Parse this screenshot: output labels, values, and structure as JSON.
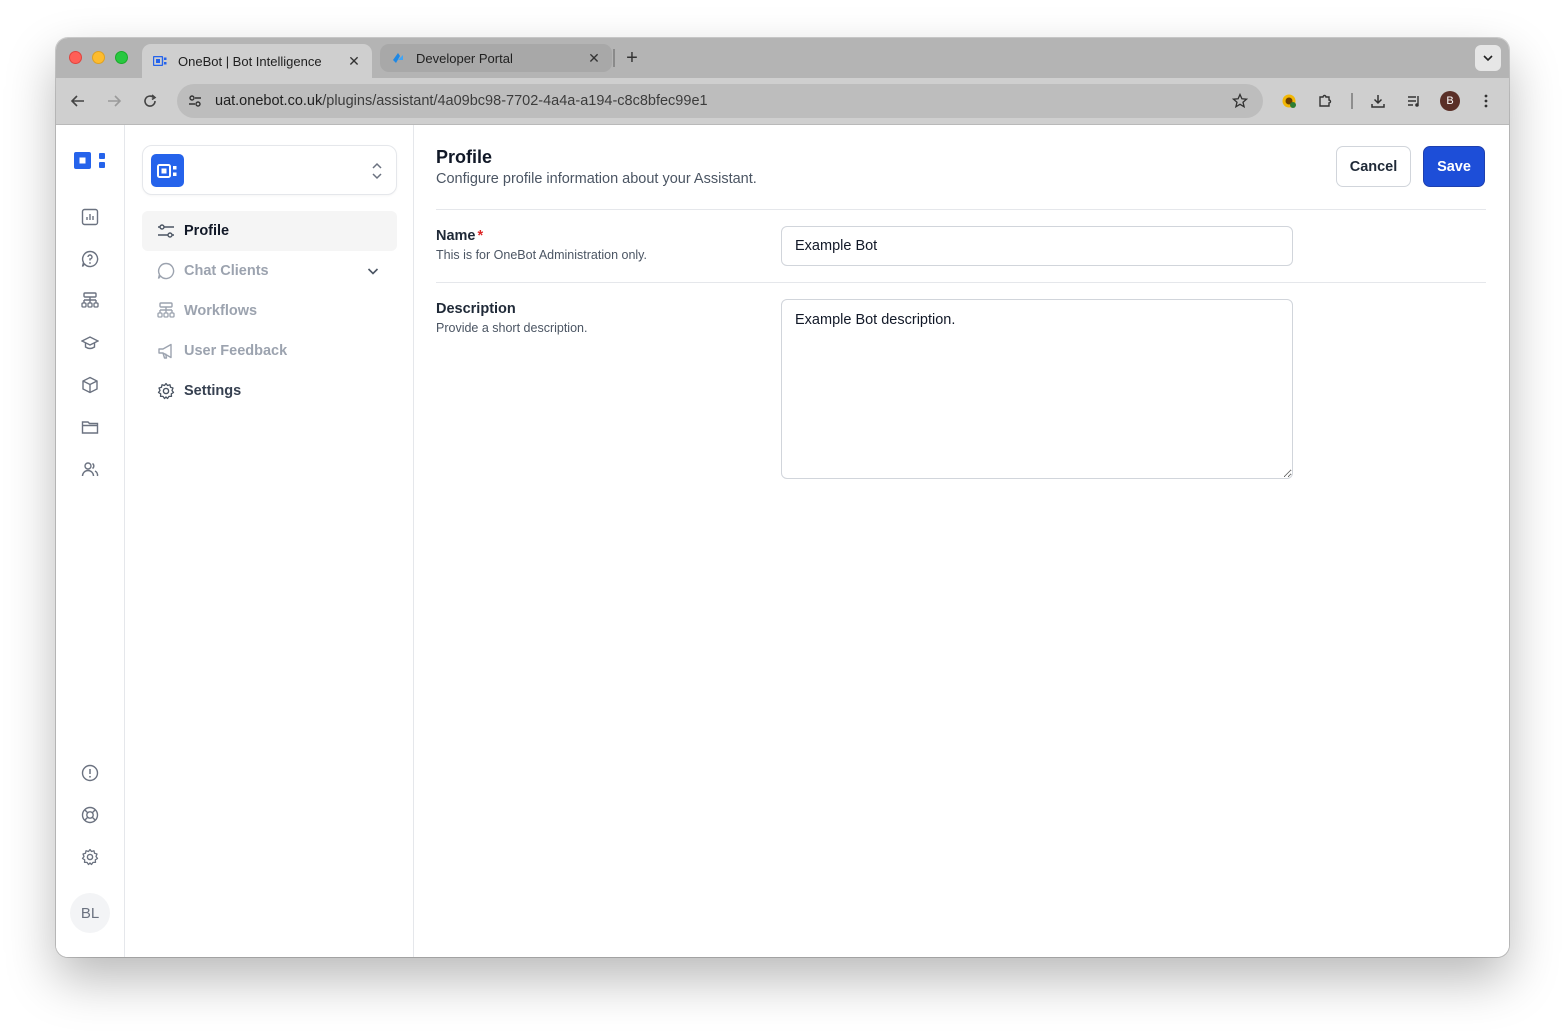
{
  "browser": {
    "tabs": [
      {
        "title": "OneBot | Bot Intelligence",
        "active": true,
        "favicon": "onebot-favicon"
      },
      {
        "title": "Developer Portal",
        "active": false,
        "favicon": "developer-portal-favicon"
      }
    ],
    "url_host": "uat.onebot.co.uk",
    "url_path": "/plugins/assistant/4a09bc98-7702-4a4a-a194-c8c8bfec99e1",
    "profile_initial": "B"
  },
  "rail": {
    "top_icons": [
      "analytics-icon",
      "chat-help-icon",
      "workflow-icon",
      "training-icon",
      "package-icon",
      "folder-icon",
      "users-icon"
    ],
    "bottom_icons": [
      "alert-icon",
      "support-icon",
      "settings-icon"
    ],
    "user_initials": "BL"
  },
  "subnav": {
    "items": [
      {
        "label": "Profile",
        "icon": "sliders-icon",
        "state": "active"
      },
      {
        "label": "Chat Clients",
        "icon": "chat-bubble-icon",
        "state": "dim",
        "expandable": true
      },
      {
        "label": "Workflows",
        "icon": "workflow-icon",
        "state": "dim"
      },
      {
        "label": "User Feedback",
        "icon": "megaphone-icon",
        "state": "dim"
      },
      {
        "label": "Settings",
        "icon": "gear-icon",
        "state": "normal"
      }
    ]
  },
  "main": {
    "title": "Profile",
    "subtitle": "Configure profile information about your Assistant.",
    "cancel_label": "Cancel",
    "save_label": "Save",
    "name": {
      "label": "Name",
      "required_mark": "*",
      "help": "This is for OneBot Administration only.",
      "value": "Example Bot"
    },
    "description": {
      "label": "Description",
      "help": "Provide a short description.",
      "value": "Example Bot description."
    }
  },
  "colors": {
    "primary": "#1d4ed8",
    "brand": "#2563eb",
    "required": "#dc2626"
  }
}
